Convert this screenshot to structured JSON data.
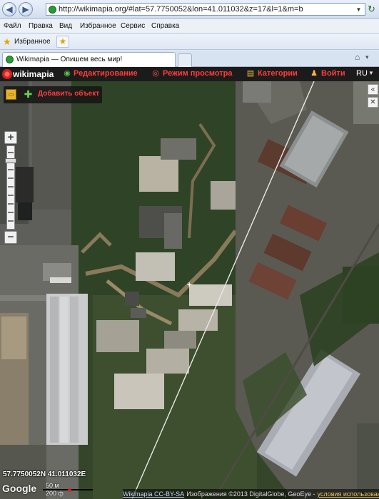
{
  "browser": {
    "url": "http://wikimapia.org/#lat=57.7750052&lon=41.011032&z=17&l=1&m=b",
    "menu": [
      "Файл",
      "Правка",
      "Вид",
      "Избранное",
      "Сервис",
      "Справка"
    ],
    "favorites_label": "Избранное",
    "tab_title": "Wikimapia — Опишем весь мир!"
  },
  "wikimapia": {
    "logo": "wikimapia",
    "nav": [
      {
        "label": "Редактирование",
        "icon": "globe-icon",
        "color": "#ff3d3d"
      },
      {
        "label": "Режим просмотра",
        "icon": "eye-icon",
        "color": "#ff3d3d"
      },
      {
        "label": "Категории",
        "icon": "categories-icon",
        "color": "#ff3d3d"
      },
      {
        "label": "Войти",
        "icon": "user-icon",
        "color": "#ff3d3d"
      }
    ],
    "language": "RU"
  },
  "map": {
    "tools": {
      "add_object": "Добавить объект"
    },
    "coordinates": "57.7750052N 41.011032E",
    "google": "Google",
    "scale_top": "50 м",
    "scale_bottom": "200 ф",
    "attribution_link": "Wikimapia CC-BY-SA",
    "attribution_text": "Изображения ©2013 DigitalGlobe, GeoEye -",
    "attribution_terms": "условия использования"
  }
}
